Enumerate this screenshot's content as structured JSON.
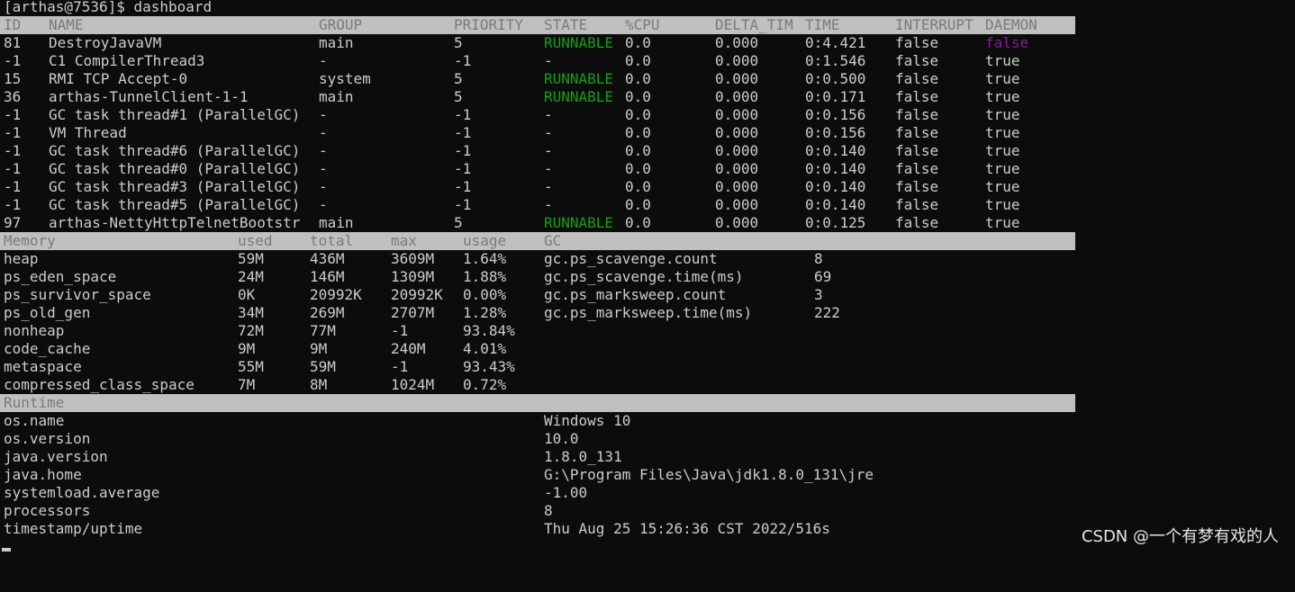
{
  "prompt": "[arthas@7536]$ dashboard",
  "colors": {
    "runnable": "#13a10e",
    "daemon_false": "#881798",
    "header_bg": "#c0c0c0",
    "header_fg": "#7a7a7a"
  },
  "threads": {
    "headers": [
      "ID",
      "NAME",
      "GROUP",
      "PRIORITY",
      "STATE",
      "%CPU",
      "DELTA_TIM",
      "TIME",
      "INTERRUPT",
      "DAEMON"
    ],
    "rows": [
      {
        "id": "81",
        "name": "DestroyJavaVM",
        "group": "main",
        "priority": "5",
        "state": "RUNNABLE",
        "cpu": "0.0",
        "delta": "0.000",
        "time": "0:4.421",
        "interrupt": "false",
        "daemon": "false"
      },
      {
        "id": "-1",
        "name": "C1 CompilerThread3",
        "group": "-",
        "priority": "-1",
        "state": "-",
        "cpu": "0.0",
        "delta": "0.000",
        "time": "0:1.546",
        "interrupt": "false",
        "daemon": "true"
      },
      {
        "id": "15",
        "name": "RMI TCP Accept-0",
        "group": "system",
        "priority": "5",
        "state": "RUNNABLE",
        "cpu": "0.0",
        "delta": "0.000",
        "time": "0:0.500",
        "interrupt": "false",
        "daemon": "true"
      },
      {
        "id": "36",
        "name": "arthas-TunnelClient-1-1",
        "group": "main",
        "priority": "5",
        "state": "RUNNABLE",
        "cpu": "0.0",
        "delta": "0.000",
        "time": "0:0.171",
        "interrupt": "false",
        "daemon": "true"
      },
      {
        "id": "-1",
        "name": "GC task thread#1 (ParallelGC)",
        "group": "-",
        "priority": "-1",
        "state": "-",
        "cpu": "0.0",
        "delta": "0.000",
        "time": "0:0.156",
        "interrupt": "false",
        "daemon": "true"
      },
      {
        "id": "-1",
        "name": "VM Thread",
        "group": "-",
        "priority": "-1",
        "state": "-",
        "cpu": "0.0",
        "delta": "0.000",
        "time": "0:0.156",
        "interrupt": "false",
        "daemon": "true"
      },
      {
        "id": "-1",
        "name": "GC task thread#6 (ParallelGC)",
        "group": "-",
        "priority": "-1",
        "state": "-",
        "cpu": "0.0",
        "delta": "0.000",
        "time": "0:0.140",
        "interrupt": "false",
        "daemon": "true"
      },
      {
        "id": "-1",
        "name": "GC task thread#0 (ParallelGC)",
        "group": "-",
        "priority": "-1",
        "state": "-",
        "cpu": "0.0",
        "delta": "0.000",
        "time": "0:0.140",
        "interrupt": "false",
        "daemon": "true"
      },
      {
        "id": "-1",
        "name": "GC task thread#3 (ParallelGC)",
        "group": "-",
        "priority": "-1",
        "state": "-",
        "cpu": "0.0",
        "delta": "0.000",
        "time": "0:0.140",
        "interrupt": "false",
        "daemon": "true"
      },
      {
        "id": "-1",
        "name": "GC task thread#5 (ParallelGC)",
        "group": "-",
        "priority": "-1",
        "state": "-",
        "cpu": "0.0",
        "delta": "0.000",
        "time": "0:0.140",
        "interrupt": "false",
        "daemon": "true"
      },
      {
        "id": "97",
        "name": "arthas-NettyHttpTelnetBootstr",
        "group": "main",
        "priority": "5",
        "state": "RUNNABLE",
        "cpu": "0.0",
        "delta": "0.000",
        "time": "0:0.125",
        "interrupt": "false",
        "daemon": "true"
      }
    ]
  },
  "memory": {
    "headers": [
      "Memory",
      "used",
      "total",
      "max",
      "usage",
      "GC"
    ],
    "rows": [
      {
        "name": "heap",
        "used": "59M",
        "total": "436M",
        "max": "3609M",
        "usage": "1.64%"
      },
      {
        "name": "ps_eden_space",
        "used": "24M",
        "total": "146M",
        "max": "1309M",
        "usage": "1.88%"
      },
      {
        "name": "ps_survivor_space",
        "used": "0K",
        "total": "20992K",
        "max": "20992K",
        "usage": "0.00%"
      },
      {
        "name": "ps_old_gen",
        "used": "34M",
        "total": "269M",
        "max": "2707M",
        "usage": "1.28%"
      },
      {
        "name": "nonheap",
        "used": "72M",
        "total": "77M",
        "max": "-1",
        "usage": "93.84%"
      },
      {
        "name": "code_cache",
        "used": "9M",
        "total": "9M",
        "max": "240M",
        "usage": "4.01%"
      },
      {
        "name": "metaspace",
        "used": "55M",
        "total": "59M",
        "max": "-1",
        "usage": "93.43%"
      },
      {
        "name": "compressed_class_space",
        "used": "7M",
        "total": "8M",
        "max": "1024M",
        "usage": "0.72%"
      }
    ],
    "gc": [
      {
        "name": "gc.ps_scavenge.count",
        "value": "8"
      },
      {
        "name": "gc.ps_scavenge.time(ms)",
        "value": "69"
      },
      {
        "name": "gc.ps_marksweep.count",
        "value": "3"
      },
      {
        "name": "gc.ps_marksweep.time(ms)",
        "value": "222"
      }
    ]
  },
  "runtime": {
    "header": "Runtime",
    "rows": [
      {
        "key": "os.name",
        "value": "Windows 10"
      },
      {
        "key": "os.version",
        "value": "10.0"
      },
      {
        "key": "java.version",
        "value": "1.8.0_131"
      },
      {
        "key": "java.home",
        "value": "G:\\Program Files\\Java\\jdk1.8.0_131\\jre"
      },
      {
        "key": "systemload.average",
        "value": "-1.00"
      },
      {
        "key": "processors",
        "value": "8"
      },
      {
        "key": "timestamp/uptime",
        "value": "Thu Aug 25 15:26:36 CST 2022/516s"
      }
    ]
  },
  "watermark": "CSDN @一个有梦有戏的人"
}
